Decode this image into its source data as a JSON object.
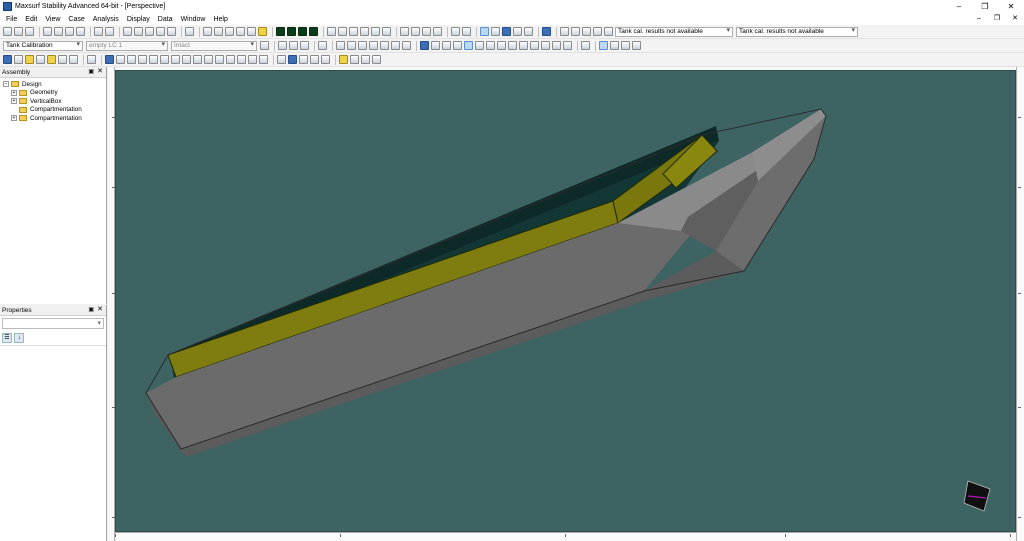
{
  "window": {
    "title": "Maxsurf Stability Advanced 64-bit - [Perspective]"
  },
  "menu": [
    "File",
    "Edit",
    "View",
    "Case",
    "Analysis",
    "Display",
    "Data",
    "Window",
    "Help"
  ],
  "toolbar": {
    "analysis_mode": "Tank Calibration",
    "loadcase": "empty LC 1",
    "damage_case": "Intact",
    "tank_cal_status_1": "Tank cal. results not available",
    "tank_cal_status_2": "Tank cal. results not available"
  },
  "assembly": {
    "title": "Assembly",
    "root": "Design",
    "items": [
      "Geometry",
      "VerticalBox",
      "Compartmentation",
      "Compartmentation"
    ]
  },
  "properties": {
    "title": "Properties"
  },
  "colors": {
    "viewport_bg": "#3e6363",
    "hull_grey": "#6b6b6b",
    "compartment_yellow": "#7f7d0f",
    "deck_dark": "#0e2e2c"
  }
}
